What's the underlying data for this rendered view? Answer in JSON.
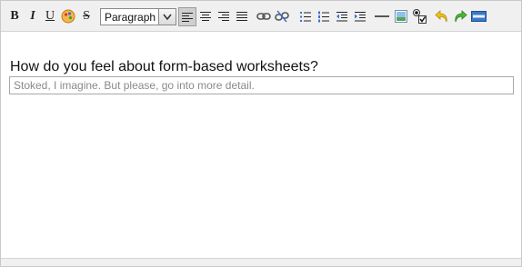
{
  "toolbar": {
    "bold_label": "B",
    "italic_label": "I",
    "underline_label": "U",
    "strike_label": "S",
    "format_value": "Paragraph"
  },
  "content": {
    "question": "How do you feel about form-based worksheets?",
    "answer_placeholder": "Stoked, I imagine.  But please, go into more detail."
  },
  "icons": [
    "bold-icon",
    "italic-icon",
    "underline-icon",
    "style-icon",
    "strikethrough-icon",
    "align-left-icon",
    "align-center-icon",
    "align-right-icon",
    "justify-icon",
    "link-icon",
    "unlink-icon",
    "bullet-list-icon",
    "numbered-list-icon",
    "outdent-icon",
    "indent-icon",
    "horizontal-rule-icon",
    "image-icon",
    "form-field-icon",
    "undo-icon",
    "redo-icon",
    "html-source-icon"
  ],
  "colors": {
    "toolbar_bg": "#f0f0f0",
    "border": "#c8c8c8",
    "undo": "#e8b400",
    "redo": "#3aa12a",
    "html": "#3a78c8"
  }
}
